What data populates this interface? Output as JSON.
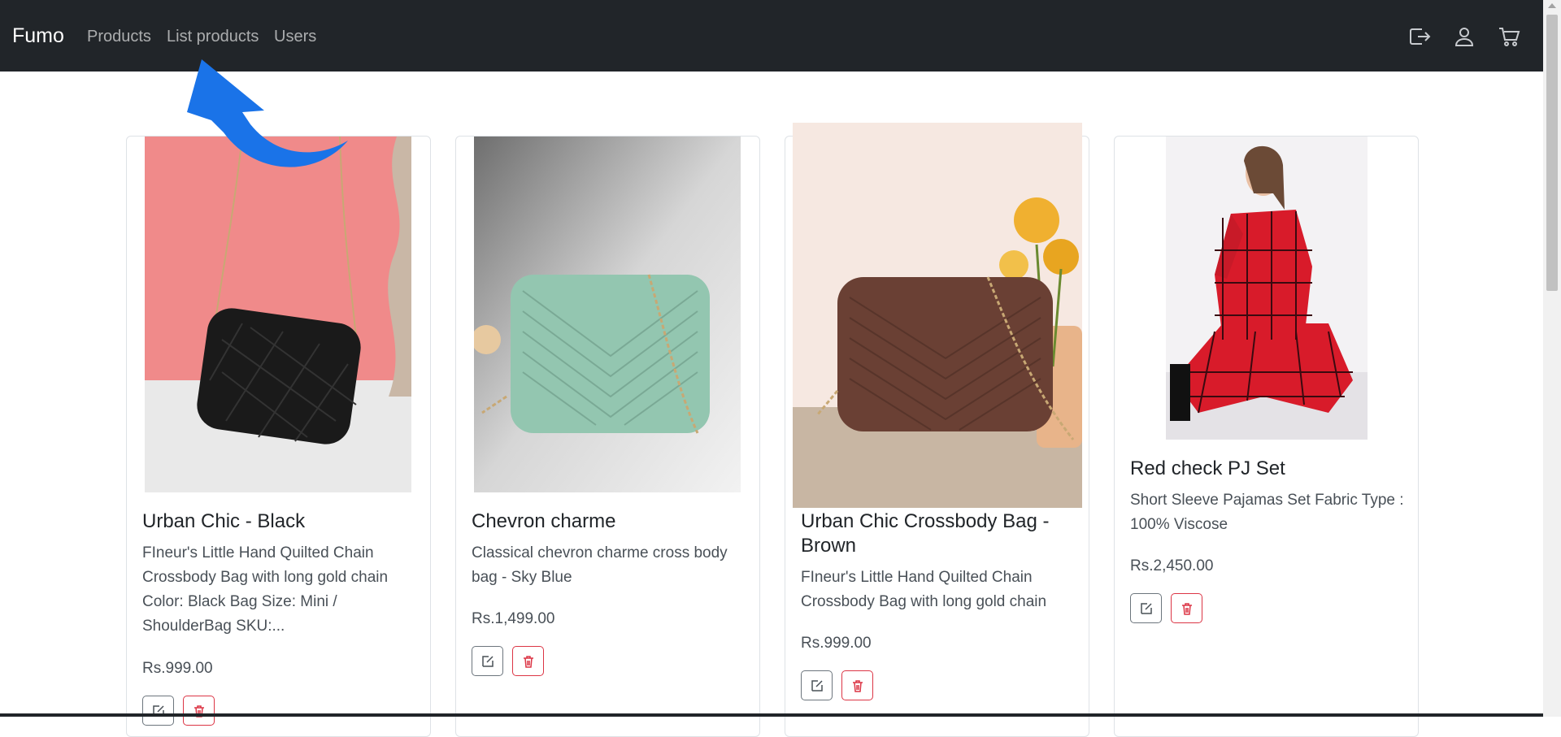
{
  "navbar": {
    "brand": "Fumo",
    "links": [
      "Products",
      "List products",
      "Users"
    ]
  },
  "icons": {
    "logout": "logout-icon",
    "user": "user-icon",
    "cart": "cart-icon"
  },
  "colors": {
    "navbar_bg": "#212529",
    "annotation_arrow": "#1a73e8",
    "delete_red": "#dc3545"
  },
  "products": [
    {
      "title": "Urban Chic - Black",
      "description": "FIneur's Little Hand Quilted Chain Crossbody Bag with long gold chain Color: Black Bag Size: Mini / ShoulderBag SKU:...",
      "price": "Rs.999.00"
    },
    {
      "title": "Chevron charme",
      "description": "Classical chevron charme cross body bag - Sky Blue",
      "price": "Rs.1,499.00"
    },
    {
      "title": "Urban Chic Crossbody Bag - Brown",
      "description": "FIneur's Little Hand Quilted Chain Crossbody Bag with long gold chain",
      "price": "Rs.999.00"
    },
    {
      "title": "Red check PJ Set",
      "description": "Short Sleeve Pajamas Set Fabric Type : 100% Viscose",
      "price": "Rs.2,450.00"
    }
  ]
}
